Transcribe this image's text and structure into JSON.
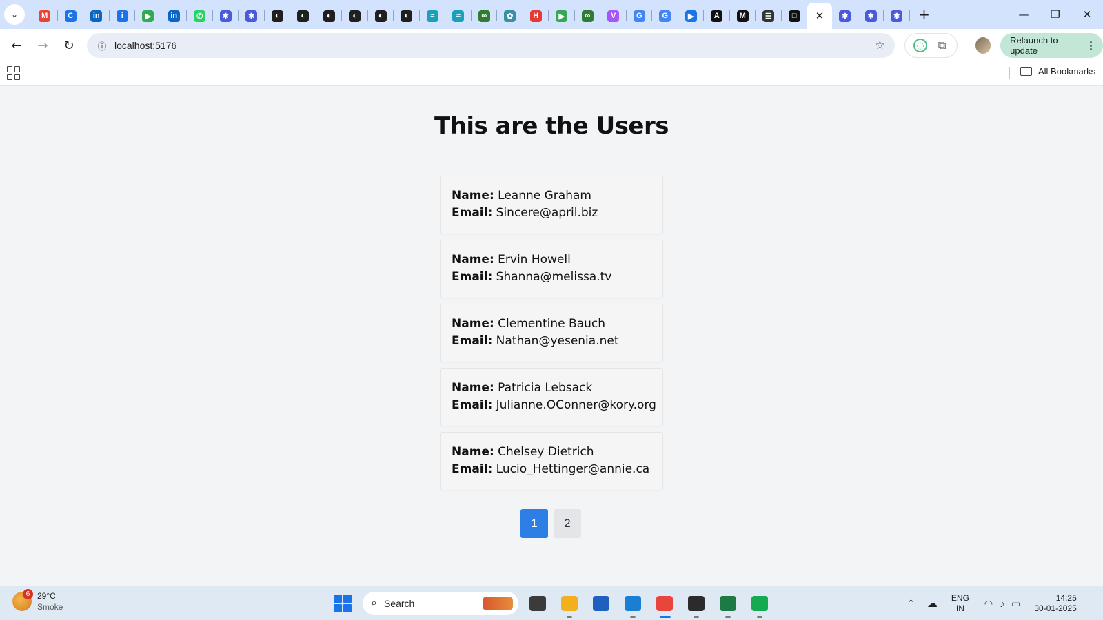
{
  "browser": {
    "tabs": [
      {
        "icon": "gmail-icon",
        "glyph": "M",
        "color": "#ea4335"
      },
      {
        "icon": "notion-icon",
        "glyph": "C",
        "color": "#1a73e8"
      },
      {
        "icon": "linkedin-icon",
        "glyph": "in",
        "color": "#0a66c2"
      },
      {
        "icon": "info-icon",
        "glyph": "i",
        "color": "#1a73e8"
      },
      {
        "icon": "meet-icon",
        "glyph": "▶",
        "color": "#34a853"
      },
      {
        "icon": "linkedin-icon",
        "glyph": "in",
        "color": "#0a66c2"
      },
      {
        "icon": "whatsapp-icon",
        "glyph": "✆",
        "color": "#25d366"
      },
      {
        "icon": "gear-icon",
        "glyph": "✱",
        "color": "#4a5bd9"
      },
      {
        "icon": "gear-icon",
        "glyph": "✱",
        "color": "#4a5bd9"
      },
      {
        "icon": "github-icon",
        "glyph": "◐",
        "color": "#1f1f1f"
      },
      {
        "icon": "github-icon",
        "glyph": "◐",
        "color": "#1f1f1f"
      },
      {
        "icon": "github-icon",
        "glyph": "◐",
        "color": "#1f1f1f"
      },
      {
        "icon": "github-icon",
        "glyph": "◐",
        "color": "#1f1f1f"
      },
      {
        "icon": "github-icon",
        "glyph": "◐",
        "color": "#1f1f1f"
      },
      {
        "icon": "github-icon",
        "glyph": "◐",
        "color": "#1f1f1f"
      },
      {
        "icon": "wave-icon",
        "glyph": "≈",
        "color": "#1aa0b8"
      },
      {
        "icon": "wave-icon",
        "glyph": "≈",
        "color": "#1aa0b8"
      },
      {
        "icon": "link-icon",
        "glyph": "∞",
        "color": "#2e7d32"
      },
      {
        "icon": "openai-icon",
        "glyph": "✿",
        "color": "#3a8fa8"
      },
      {
        "icon": "h-icon",
        "glyph": "H",
        "color": "#e53935"
      },
      {
        "icon": "meet-icon",
        "glyph": "▶",
        "color": "#34a853"
      },
      {
        "icon": "link-icon",
        "glyph": "∞",
        "color": "#2e7d32"
      },
      {
        "icon": "vite-icon",
        "glyph": "V",
        "color": "#a855f7"
      },
      {
        "icon": "google-icon",
        "glyph": "G",
        "color": "#4285f4"
      },
      {
        "icon": "google-icon",
        "glyph": "G",
        "color": "#4285f4"
      },
      {
        "icon": "video-icon",
        "glyph": "▶",
        "color": "#1a73e8"
      },
      {
        "icon": "ai-icon",
        "glyph": "A",
        "color": "#111111"
      },
      {
        "icon": "medium-icon",
        "glyph": "M",
        "color": "#111111"
      },
      {
        "icon": "reader-icon",
        "glyph": "☰",
        "color": "#333333"
      },
      {
        "icon": "square-icon",
        "glyph": "□",
        "color": "#111111"
      }
    ],
    "trailing_tabs": [
      {
        "icon": "gear-icon",
        "glyph": "✱",
        "color": "#4a5bd9"
      },
      {
        "icon": "gear-icon",
        "glyph": "✱",
        "color": "#4a5bd9"
      },
      {
        "icon": "gear-icon",
        "glyph": "✱",
        "color": "#4a5bd9"
      }
    ],
    "url": "localhost:5176",
    "relaunch_label": "Relaunch to update",
    "all_bookmarks_label": "All Bookmarks"
  },
  "page": {
    "title": "This are the Users",
    "name_label": "Name:",
    "email_label": "Email:",
    "users": [
      {
        "name": "Leanne Graham",
        "email": "Sincere@april.biz"
      },
      {
        "name": "Ervin Howell",
        "email": "Shanna@melissa.tv"
      },
      {
        "name": "Clementine Bauch",
        "email": "Nathan@yesenia.net"
      },
      {
        "name": "Patricia Lebsack",
        "email": "Julianne.OConner@kory.org"
      },
      {
        "name": "Chelsey Dietrich",
        "email": "Lucio_Hettinger@annie.ca"
      }
    ],
    "pagination": {
      "pages": [
        "1",
        "2"
      ],
      "current": "1"
    }
  },
  "taskbar": {
    "weather": {
      "badge": "6",
      "temp": "29°C",
      "condition": "Smoke"
    },
    "search_placeholder": "Search",
    "apps": [
      {
        "name": "task-view-icon",
        "color": "#3b3b3b",
        "indicator": "none"
      },
      {
        "name": "file-explorer-icon",
        "color": "#f2b01e",
        "indicator": "open"
      },
      {
        "name": "store-icon",
        "color": "#1f5fbf",
        "indicator": "none"
      },
      {
        "name": "vscode-icon",
        "color": "#1a7fd4",
        "indicator": "open"
      },
      {
        "name": "chrome-icon",
        "color": "#e8453c",
        "indicator": "active"
      },
      {
        "name": "terminal-icon",
        "color": "#2b2b2b",
        "indicator": "open"
      },
      {
        "name": "excel-icon",
        "color": "#1d7a45",
        "indicator": "open"
      },
      {
        "name": "mongodb-icon",
        "color": "#13aa52",
        "indicator": "open"
      }
    ],
    "lang": {
      "line1": "ENG",
      "line2": "IN"
    },
    "time": "14:25",
    "date": "30-01-2025"
  }
}
